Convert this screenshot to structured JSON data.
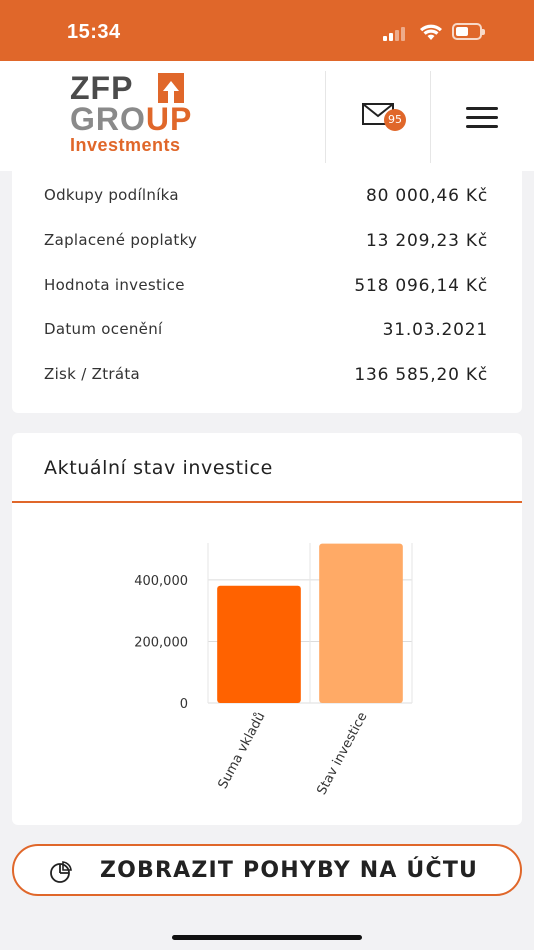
{
  "status_bar": {
    "time": "15:34"
  },
  "header": {
    "logo": {
      "line1": "ZFP",
      "line2_gray": "GRO",
      "line2_orange": "UP",
      "line3": "Investments"
    },
    "mail_badge_count": "95",
    "icons": {
      "mail": "mail-icon",
      "menu": "hamburger-menu-icon"
    }
  },
  "summary": {
    "rows": [
      {
        "label": "Odkupy podílníka",
        "value": "80 000,46 Kč"
      },
      {
        "label": "Zaplacené poplatky",
        "value": "13 209,23 Kč"
      },
      {
        "label": "Hodnota investice",
        "value": "518 096,14 Kč"
      },
      {
        "label": "Datum ocenění",
        "value": "31.03.2021"
      },
      {
        "label": "Zisk / Ztráta",
        "value": "136 585,20 Kč"
      }
    ]
  },
  "chart_card": {
    "title": "Aktuální stav investice"
  },
  "chart_data": {
    "type": "bar",
    "categories": [
      "Suma vkladů",
      "Stav investice"
    ],
    "values": [
      381000,
      518096.14
    ],
    "ylim": [
      0,
      520000
    ],
    "yticks": [
      0,
      200000,
      400000
    ],
    "ytick_labels": [
      "0",
      "200,000",
      "400,000"
    ],
    "colors": [
      "#ff6200",
      "#ffaa66"
    ],
    "grid": true,
    "legend": "none"
  },
  "action_button": {
    "label": "ZOBRAZIT POHYBY NA ÚČTU",
    "icon": "pie-chart-icon"
  },
  "colors": {
    "brand_orange": "#e0672a"
  }
}
